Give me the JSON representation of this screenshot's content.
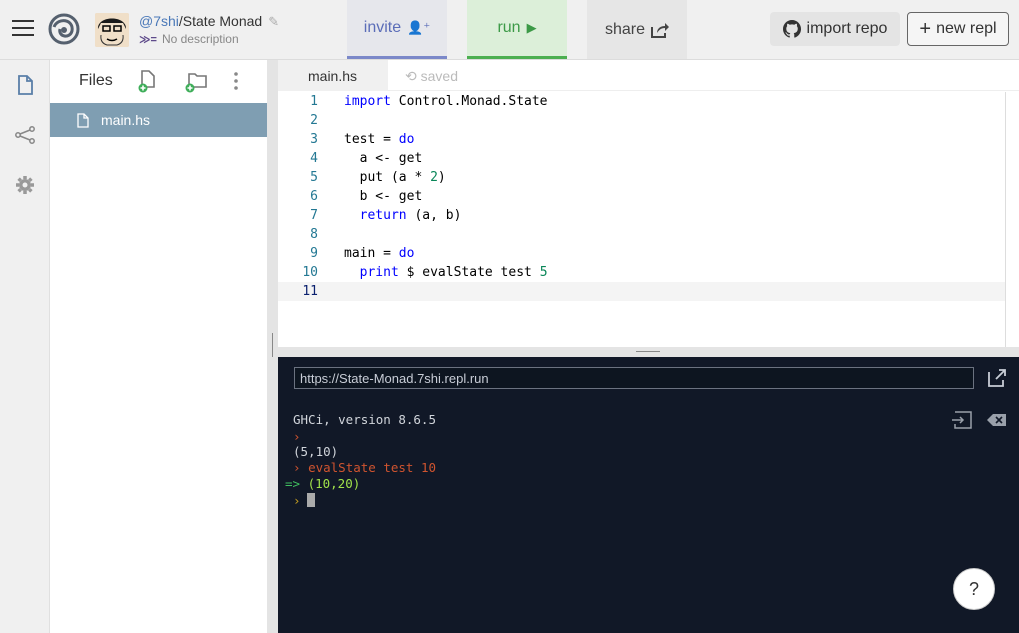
{
  "header": {
    "user": "@7shi",
    "separator": "/",
    "repl_name": "State Monad",
    "description": "No description",
    "language_icon": "haskell-icon",
    "invite_label": "invite",
    "run_label": "run",
    "share_label": "share",
    "import_label": "import repo",
    "new_label": "new repl"
  },
  "sidebar": {
    "items": [
      {
        "icon": "file-icon"
      },
      {
        "icon": "version-control-icon"
      },
      {
        "icon": "gear-icon"
      }
    ]
  },
  "files": {
    "title": "Files",
    "items": [
      {
        "name": "main.hs",
        "selected": true
      }
    ]
  },
  "editor": {
    "tab": "main.hs",
    "status": "saved",
    "lines": [
      "import Control.Monad.State",
      "",
      "test = do",
      "  a <- get",
      "  put (a * 2)",
      "  b <- get",
      "  return (a, b)",
      "",
      "main = do",
      "  print $ evalState test 5",
      ""
    ],
    "active_line": 11
  },
  "console": {
    "url": "https://State-Monad.7shi.repl.run",
    "lines": [
      {
        "kind": "info",
        "text": "GHCi, version 8.6.5"
      },
      {
        "kind": "prompt",
        "text": ""
      },
      {
        "kind": "info",
        "text": "(5,10)"
      },
      {
        "kind": "cmd",
        "text": "evalState test 10"
      },
      {
        "kind": "result",
        "text": "(10,20)"
      },
      {
        "kind": "prompt-active",
        "text": ""
      }
    ],
    "help_label": "?"
  },
  "colors": {
    "run": "#3c9a47",
    "invite": "#5b6db8",
    "file_selected": "#7f9eb2",
    "console_bg": "#111827"
  }
}
